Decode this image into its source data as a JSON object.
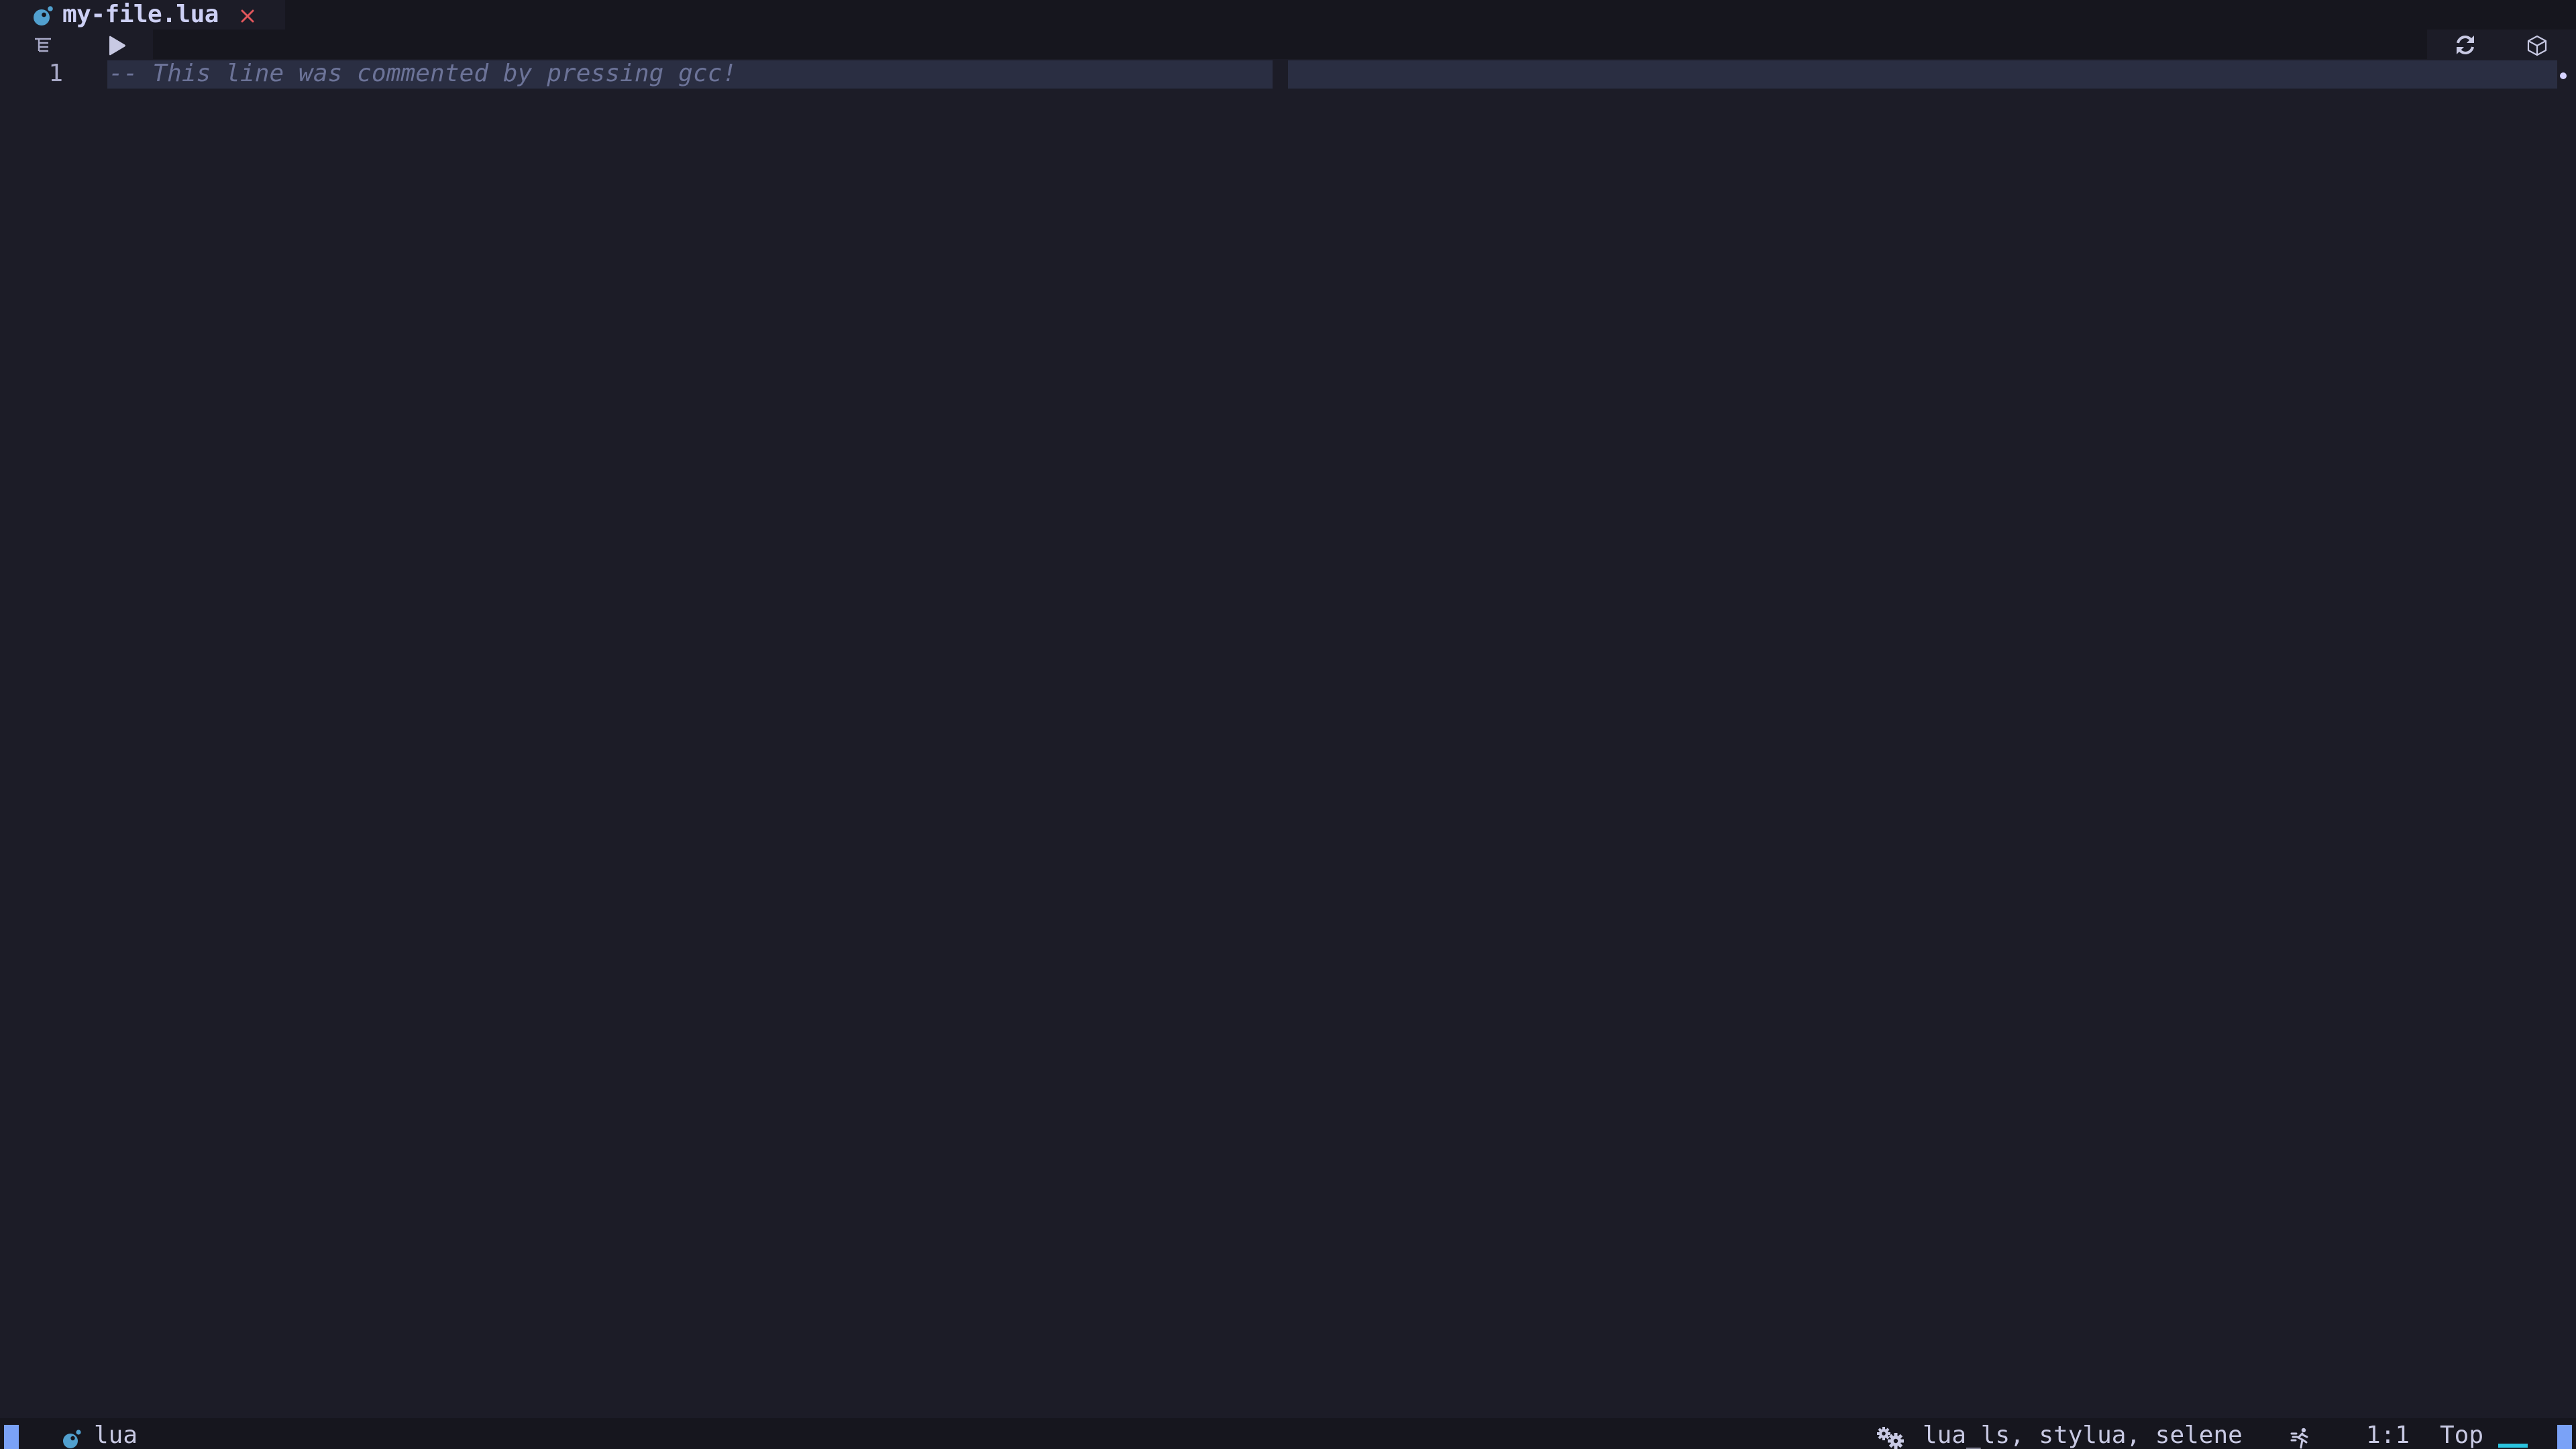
{
  "tabline": {
    "tabs": [
      {
        "name": "my-file.lua",
        "icon": "lua-icon",
        "close_icon": "close-icon",
        "active": true
      }
    ]
  },
  "winbar": {
    "left_icons": [
      "outline-icon",
      "run-icon"
    ],
    "right_icons": [
      "sync-icon",
      "package-box-icon"
    ]
  },
  "editor": {
    "lines": [
      {
        "number": "1",
        "text": "-- This line was commented by pressing gcc!",
        "is_comment": true,
        "is_cursorline": true
      }
    ],
    "colorcolumn": 80
  },
  "statusline": {
    "mode_color": "#7aa2f7",
    "filetype_icon": "lua-icon",
    "filetype": "lua",
    "lsp_icon": "gears-icon",
    "lsp_clients": "lua_ls, stylua, selene",
    "activity_icon": "running-person-icon",
    "position": "1:1",
    "scroll": "Top",
    "scroll_progress": 0,
    "progress_color": "#2ac3de"
  },
  "colors": {
    "background": "#1c1c27",
    "tabline_fill": "#16161e",
    "cursorline": "#2a2e42",
    "comment": "#6c7398",
    "lua_icon": "#51a0cf",
    "close_icon": "#e0565b",
    "foreground": "#c8c9e3"
  }
}
